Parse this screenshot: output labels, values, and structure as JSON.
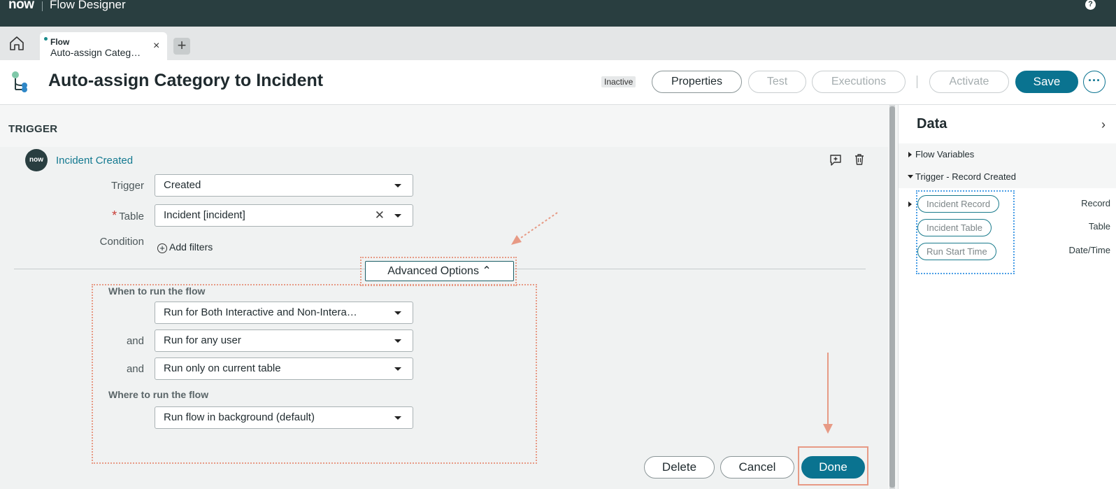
{
  "topbar": {
    "logo": "now",
    "app_title": "Flow Designer",
    "help": "?"
  },
  "tabs": {
    "active_kind": "Flow",
    "active_name": "Auto-assign Categ…",
    "close": "×",
    "add": "+"
  },
  "header": {
    "title": "Auto-assign Category to Incident",
    "status": "Inactive",
    "buttons": {
      "properties": "Properties",
      "test": "Test",
      "executions": "Executions",
      "activate": "Activate",
      "save": "Save",
      "more": "···"
    }
  },
  "trigger": {
    "section_label": "TRIGGER",
    "badge": "now",
    "name": "Incident Created",
    "fields": {
      "trigger_label": "Trigger",
      "trigger_value": "Created",
      "table_label": "Table",
      "table_required": "*",
      "table_value": "Incident [incident]",
      "condition_label": "Condition",
      "add_filters": "Add filters"
    },
    "advanced": {
      "toggle": "Advanced Options",
      "when_heading": "When to run the flow",
      "run_for": "Run for Both Interactive and Non-Intera…",
      "and1": "and",
      "user": "Run for any user",
      "and2": "and",
      "table_scope": "Run only on current table",
      "where_heading": "Where to run the flow",
      "where_value": "Run flow in background (default)"
    },
    "actions": {
      "delete": "Delete",
      "cancel": "Cancel",
      "done": "Done"
    }
  },
  "data_panel": {
    "title": "Data",
    "sections": [
      {
        "label": "Flow Variables"
      },
      {
        "label": "Trigger - Record Created"
      }
    ],
    "pills": [
      {
        "label": "Incident Record",
        "type": "Record"
      },
      {
        "label": "Incident Table",
        "type": "Table"
      },
      {
        "label": "Run Start Time",
        "type": "Date/Time"
      }
    ]
  },
  "colors": {
    "topbar": "#293e40",
    "accent": "#0a7390",
    "annotation_red": "#e79a85",
    "annotation_blue": "#4a9ee6"
  }
}
